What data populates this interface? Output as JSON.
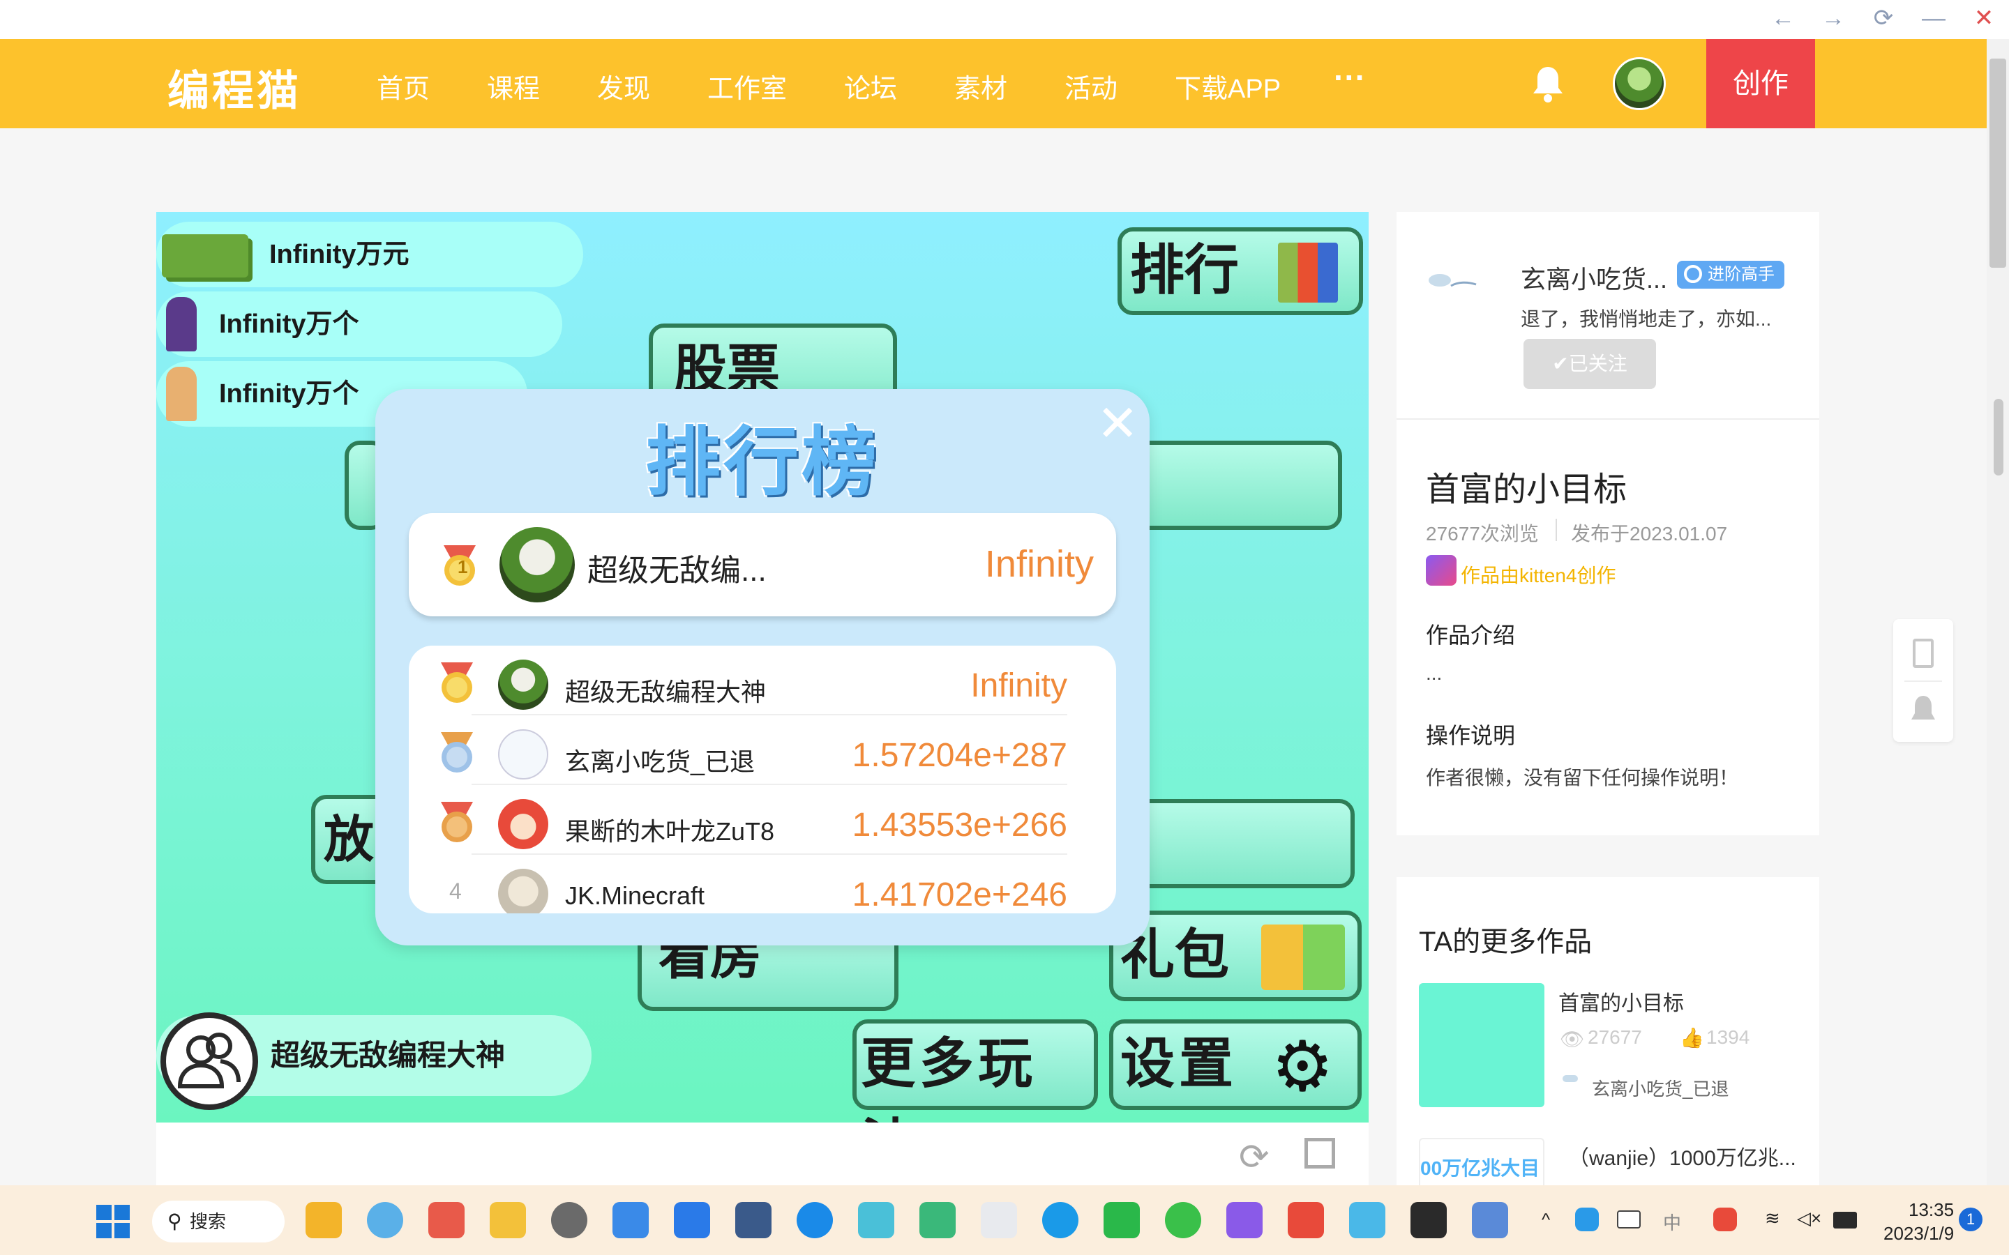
{
  "window": {
    "back": "←",
    "forward": "→",
    "refresh": "⟳",
    "minimize": "—",
    "close": "✕"
  },
  "header": {
    "logo": "编程猫",
    "nav": [
      "首页",
      "课程",
      "发现",
      "工作室",
      "论坛",
      "素材",
      "活动",
      "下载APP"
    ],
    "more": "···",
    "create": "创作"
  },
  "game": {
    "money": "Infinity万元",
    "stat2": "Infinity万个",
    "stat3": "Infinity万个",
    "btn_rank": "排行",
    "btn_stock": "股票",
    "btn_fang": "放",
    "btn_house": "看房",
    "btn_gift": "礼包",
    "btn_more": "更多玩法",
    "btn_settings": "设置",
    "player": "超级无敌编程大神"
  },
  "leaderboard": {
    "title": "排行榜",
    "close": "✕",
    "me": {
      "rank": "1",
      "name": "超级无敌编...",
      "score": "Infinity"
    },
    "rows": [
      {
        "rank": "1",
        "name": "超级无敌编程大神",
        "score": "Infinity"
      },
      {
        "rank": "2",
        "name": "玄离小吃货_已退",
        "score": "1.57204e+287"
      },
      {
        "rank": "3",
        "name": "果断的木叶龙ZuT8",
        "score": "1.43553e+266"
      },
      {
        "rank": "4",
        "name": "JK.Minecraft",
        "score": "1.41702e+246"
      }
    ]
  },
  "author": {
    "name": "玄离小吃货...",
    "badge": "进阶高手",
    "desc": "退了，我悄悄地走了，亦如...",
    "follow": "✔已关注"
  },
  "work": {
    "title": "首富的小目标",
    "views": "27677次浏览",
    "published": "发布于2023.01.07",
    "made_with": "作品由kitten4创作",
    "intro_title": "作品介绍",
    "intro": "...",
    "ops_title": "操作说明",
    "ops": "作者很懒，没有留下任何操作说明！"
  },
  "more_works": {
    "title": "TA的更多作品",
    "items": [
      {
        "title": "首富的小目标",
        "views": "27677",
        "likes": "1394",
        "author": "玄离小吃货_已退"
      },
      {
        "title": "（wanjie）1000万亿兆...",
        "thumb_text": "00万亿兆大目"
      }
    ]
  },
  "taskbar": {
    "search": "搜索",
    "ime": "中",
    "time": "13:35",
    "date": "2023/1/9",
    "notif": "1"
  },
  "colors": {
    "brand": "#fdc22c",
    "create": "#ee4549",
    "score": "#f08a3a",
    "accent": "#5fb6f5"
  }
}
